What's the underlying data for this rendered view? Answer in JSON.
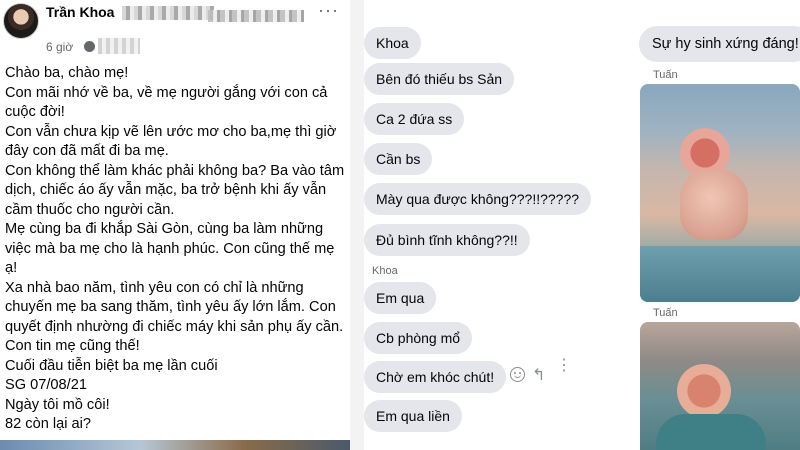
{
  "post": {
    "author": "Trần Khoa",
    "time": "6 giờ",
    "lines": [
      "Chào ba, chào mẹ!",
      "Con mãi nhớ về ba, về mẹ người gắng với con cả cuộc đời!",
      "Con vẫn chưa kịp vẽ lên ước mơ cho ba,mẹ thì giờ đây con đã mất đi ba mẹ.",
      "Con không thể làm khác phải không ba? Ba vào tâm dịch, chiếc áo ấy vẫn mặc, ba trở bệnh khi ấy vẫn cầm thuốc cho người cần.",
      "Mẹ cùng ba đi khắp Sài Gòn, cùng ba làm những việc mà ba mẹ cho là hạnh phúc. Con cũng thế mẹ ạ!",
      "Xa nhà bao năm, tình yêu con có chỉ là những chuyến mẹ ba sang thăm, tình yêu ấy lớn lắm. Con quyết định nhường đi chiếc máy khi sản phụ ấy cần. Con tin mẹ cũng thế!",
      "Cuối đầu tiễn biệt ba mẹ lần cuối",
      "SG 07/08/21",
      "Ngày tôi mồ côi!",
      "82 còn lại ai?"
    ]
  },
  "chat": {
    "sender_label": "Khoa",
    "messages": [
      "Khoa",
      "Bên đó thiếu bs Sản",
      "Ca 2 đứa ss",
      "Cần bs",
      "Mày qua được không???!!?????",
      "Đủ bình tĩnh không??!!",
      "Em qua",
      "Cb phòng mổ",
      "Chờ em khóc chút!",
      "Em qua liền"
    ],
    "icons": [
      "smile-icon",
      "reply-icon",
      "more-vertical-icon"
    ]
  },
  "right_chat": {
    "message": "Sự hy sinh xứng đáng!",
    "photo_sender_1": "Tuấn",
    "photo_sender_2": "Tuấn"
  }
}
